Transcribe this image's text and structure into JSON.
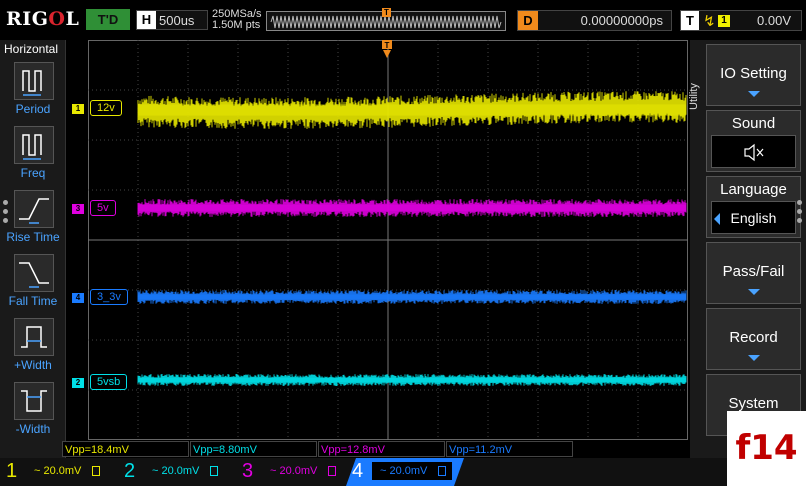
{
  "brand": "RIGOL",
  "run_state": "T'D",
  "timebase": {
    "label": "H",
    "value": "500us"
  },
  "acq": {
    "rate": "250MSa/s",
    "points": "1.50M pts"
  },
  "delay": {
    "label": "D",
    "value": "0.00000000ps"
  },
  "trigger": {
    "label": "T",
    "source": "1",
    "level": "0.00V"
  },
  "trigger_marker": "T",
  "left_menu": {
    "title": "Horizontal",
    "items": [
      {
        "label": "Period",
        "icon": "period-icon"
      },
      {
        "label": "Freq",
        "icon": "freq-icon"
      },
      {
        "label": "Rise Time",
        "icon": "rise-time-icon"
      },
      {
        "label": "Fall Time",
        "icon": "fall-time-icon"
      },
      {
        "label": "+Width",
        "icon": "pos-width-icon"
      },
      {
        "label": "-Width",
        "icon": "neg-width-icon"
      }
    ]
  },
  "right_menu": {
    "title": "Utility",
    "io_setting": "IO Setting",
    "sound": "Sound",
    "language": "Language",
    "language_value": "English",
    "pass_fail": "Pass/Fail",
    "record": "Record",
    "system": "System"
  },
  "channels": [
    {
      "num": "1",
      "label": "12v",
      "color": "#e8e800",
      "scale": "20.0mV",
      "vpp": "Vpp=18.4mV"
    },
    {
      "num": "2",
      "label": "5vsb",
      "color": "#00e0e8",
      "scale": "20.0mV",
      "vpp": "Vpp=8.80mV"
    },
    {
      "num": "3",
      "label": "5v",
      "color": "#e000e0",
      "scale": "20.0mV",
      "vpp": "Vpp=12.8mV"
    },
    {
      "num": "4",
      "label": "3_3v",
      "color": "#1a7bff",
      "scale": "20.0mV",
      "vpp": "Vpp=11.2mV"
    }
  ],
  "watermark": "f14"
}
